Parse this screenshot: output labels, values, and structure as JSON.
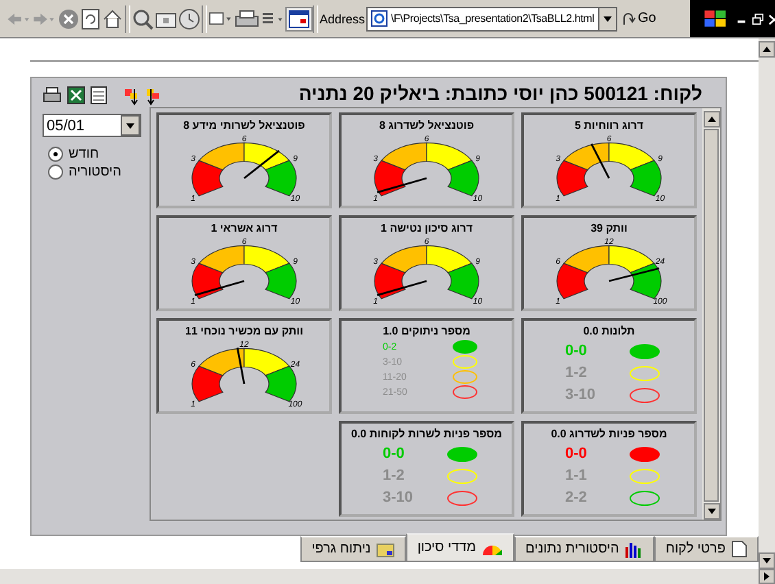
{
  "browser": {
    "address_label": "Address",
    "address": "\\F\\Projects\\Tsa_presentation2\\TsaBLL2.html",
    "go": "Go"
  },
  "header": "לקוח: 500121 כהן יוסי כתובת: ביאליק 20 נתניה",
  "period_select": {
    "value": "05/01"
  },
  "radios": [
    {
      "label": "חודש",
      "selected": true
    },
    {
      "label": "היסטוריה",
      "selected": false
    }
  ],
  "cards": [
    {
      "kind": "gauge",
      "title": "דרוג רווחיות 5",
      "ticks": [
        "1",
        "3",
        "6",
        "9",
        "10"
      ]
    },
    {
      "kind": "gauge",
      "title": "פוטנציאל לשדרוג 8",
      "ticks": [
        "1",
        "3",
        "6",
        "9",
        "10"
      ]
    },
    {
      "kind": "gauge",
      "title": "פוטנציאל לשרותי מידע 8",
      "ticks": [
        "1",
        "3",
        "6",
        "9",
        "10"
      ]
    },
    {
      "kind": "gauge",
      "title": "וותק 39",
      "ticks": [
        "1",
        "6",
        "12",
        "24",
        "100"
      ]
    },
    {
      "kind": "gauge",
      "title": "דרוג  סיכון נטישה 1",
      "ticks": [
        "1",
        "3",
        "6",
        "9",
        "10"
      ]
    },
    {
      "kind": "gauge",
      "title": "דרוג אשראי 1",
      "ticks": [
        "1",
        "3",
        "6",
        "9",
        "10"
      ]
    },
    {
      "kind": "lights",
      "title": "תלונות 0.0",
      "rows": [
        {
          "label": "0-0",
          "color": "#00cc00",
          "selected": true
        },
        {
          "label": "1-2",
          "color": "#ffff00",
          "selected": false
        },
        {
          "label": "3-10",
          "color": "#ff3333",
          "selected": false
        }
      ]
    },
    {
      "kind": "lights",
      "title": "מספר ניתוקים 1.0",
      "rows": [
        {
          "label": "0-2",
          "color": "#00cc00",
          "selected": true
        },
        {
          "label": "3-10",
          "color": "#ffff00",
          "selected": false
        },
        {
          "label": "11-20",
          "color": "#ffc000",
          "selected": false
        },
        {
          "label": "21-50",
          "color": "#ff3333",
          "selected": false
        }
      ]
    },
    {
      "kind": "gauge",
      "title": "וותק עם מכשיר נוכחי 11",
      "ticks": [
        "1",
        "6",
        "12",
        "24",
        "100"
      ]
    },
    {
      "kind": "lights",
      "title": "מספר פניות לשדרוג 0.0",
      "rows": [
        {
          "label": "0-0",
          "color": "#ff0000",
          "selected": true
        },
        {
          "label": "1-1",
          "color": "#ffff00",
          "selected": false
        },
        {
          "label": "2-2",
          "color": "#00cc00",
          "selected": false
        }
      ]
    },
    {
      "kind": "lights",
      "title": "מספר פניות לשרות לקוחות 0.0",
      "rows": [
        {
          "label": "0-0",
          "color": "#00cc00",
          "selected": true
        },
        {
          "label": "1-2",
          "color": "#ffff00",
          "selected": false
        },
        {
          "label": "3-10",
          "color": "#ff3333",
          "selected": false
        }
      ]
    }
  ],
  "tabs": [
    {
      "label": "פרטי לקוח",
      "selected": false
    },
    {
      "label": "היסטורית נתונים",
      "selected": false
    },
    {
      "label": "מדדי סיכון",
      "selected": true
    },
    {
      "label": "ניתוח גרפי",
      "selected": false
    }
  ]
}
